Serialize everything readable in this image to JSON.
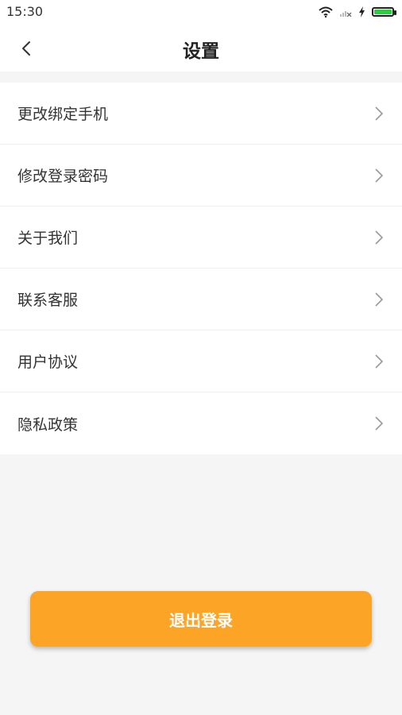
{
  "status": {
    "time": "15:30",
    "battery_level": 1.0,
    "icons": [
      "wifi-icon",
      "signal-icon",
      "charging-icon",
      "battery-icon"
    ]
  },
  "header": {
    "title": "设置",
    "back_icon": "chevron-left-icon"
  },
  "menu": {
    "items": [
      {
        "label": "更改绑定手机"
      },
      {
        "label": "修改登录密码"
      },
      {
        "label": "关于我们"
      },
      {
        "label": "联系客服"
      },
      {
        "label": "用户协议"
      },
      {
        "label": "隐私政策"
      }
    ]
  },
  "actions": {
    "logout_label": "退出登录"
  },
  "colors": {
    "accent": "#fba425",
    "background": "#f5f5f5",
    "battery": "#2ecc40"
  }
}
